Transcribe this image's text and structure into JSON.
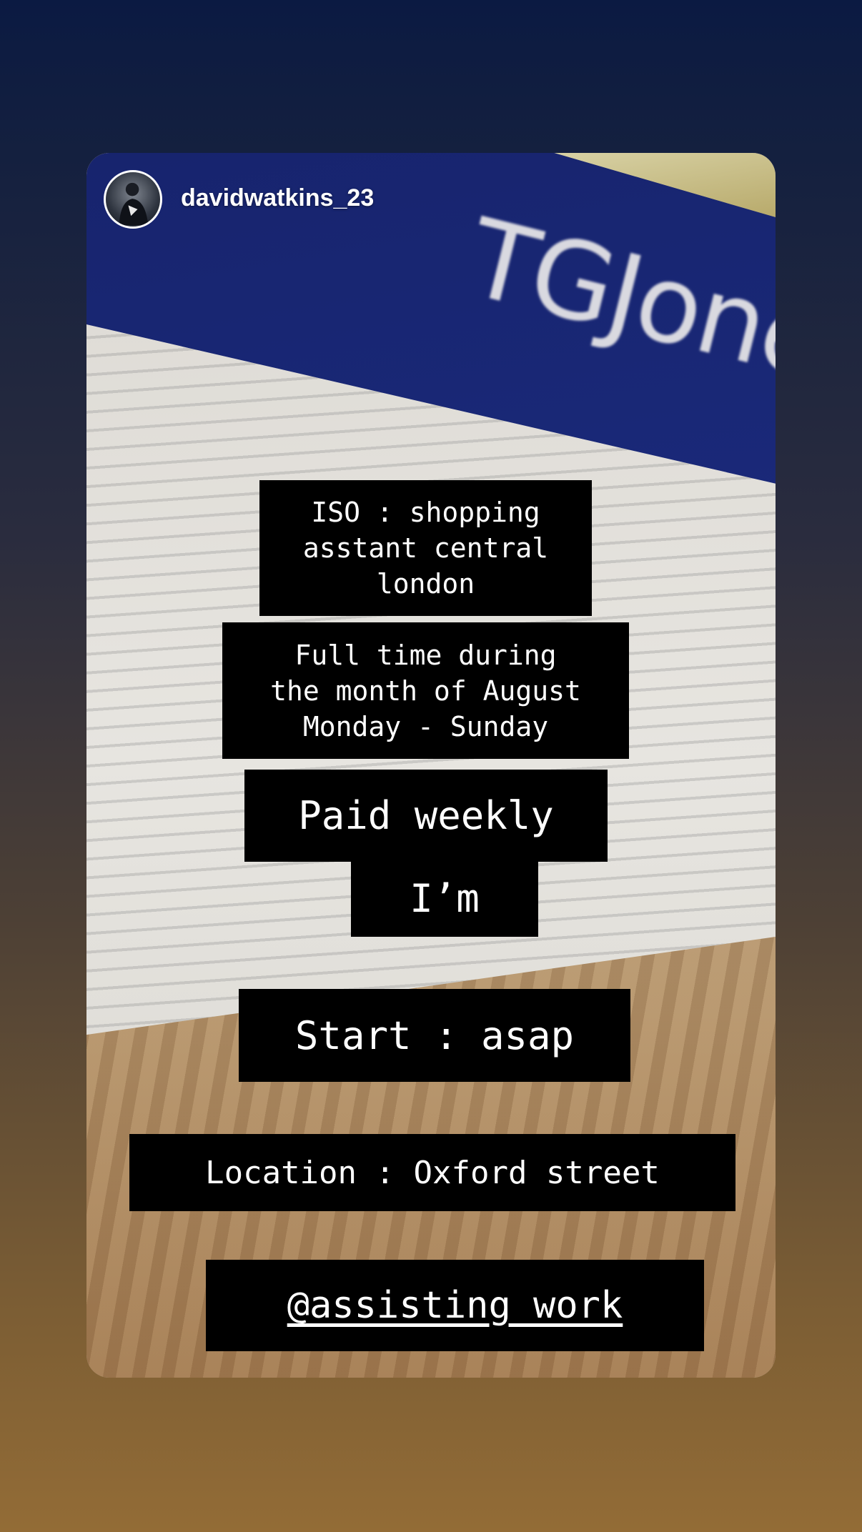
{
  "header": {
    "username": "davidwatkins_23"
  },
  "photo": {
    "sign_text": "TGJone"
  },
  "stickers": {
    "role": "ISO : shopping\nasstant central\nlondon",
    "schedule": "Full time during\nthe month of August\nMonday - Sunday",
    "pay": "Paid weekly",
    "im": "I’m",
    "start": "Start : asap",
    "location": "Location : Oxford street",
    "mention": "@assisting_work"
  },
  "colors": {
    "sticker_bg": "#000000",
    "sticker_text": "#ffffff",
    "background_top": "#0b1a42",
    "background_bottom": "#936c36"
  }
}
